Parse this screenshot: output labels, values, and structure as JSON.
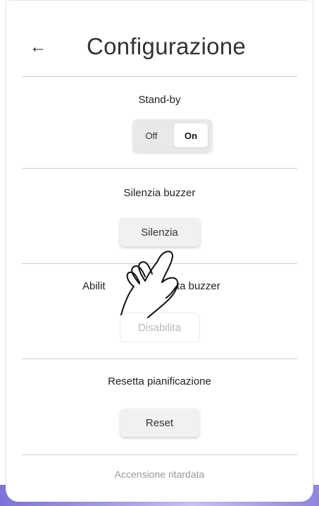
{
  "header": {
    "back_icon": "arrow-left-icon",
    "title": "Configurazione"
  },
  "standby": {
    "title": "Stand-by",
    "toggle": {
      "options": [
        "Off",
        "On"
      ],
      "selected": "On"
    }
  },
  "silence": {
    "title": "Silenzia buzzer",
    "button_label": "Silenzia"
  },
  "buzzer": {
    "title_left": "Abilit",
    "title_right": "ta buzzer",
    "button_label": "Disabilita",
    "button_state": "disabled"
  },
  "schedule": {
    "title": "Resetta pianificazione",
    "button_label": "Reset"
  },
  "footer": {
    "delayed_start": "Accensione ritardata"
  },
  "overlay": {
    "icon": "hand-pointer-icon"
  },
  "colors": {
    "divider": "#cfcfcf",
    "frame": "#8f86e2",
    "button_bg": "#f1f1f1"
  }
}
